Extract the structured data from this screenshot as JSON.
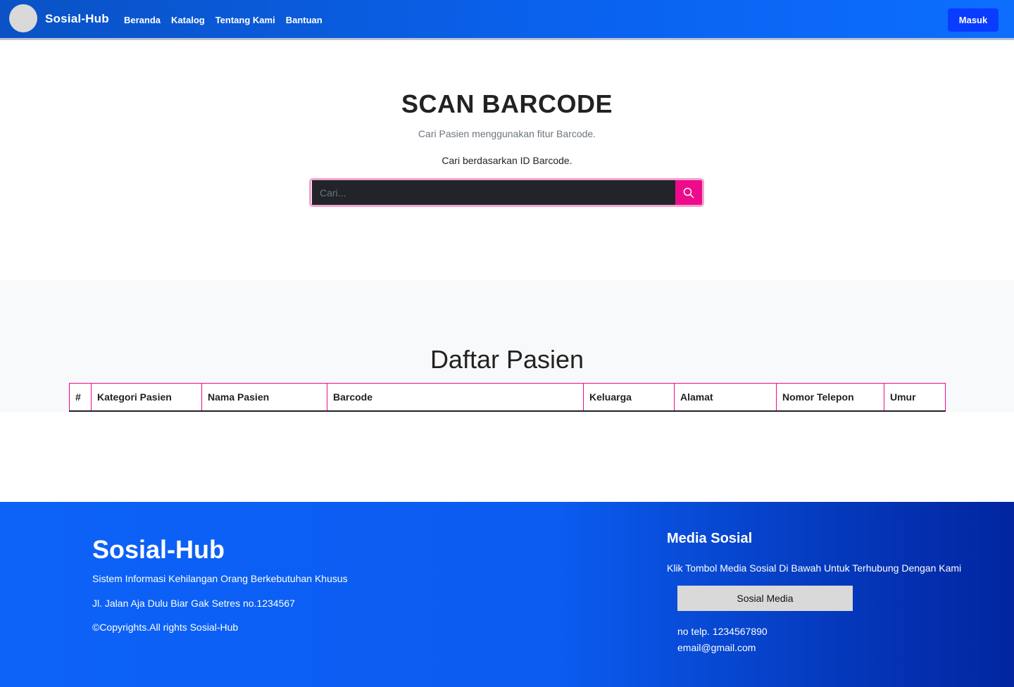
{
  "navbar": {
    "brand": "Sosial-Hub",
    "links": [
      "Beranda",
      "Katalog",
      "Tentang Kami",
      "Bantuan"
    ],
    "login_label": "Masuk"
  },
  "hero": {
    "title": "SCAN BARCODE",
    "subtitle": "Cari Pasien menggunakan fitur Barcode.",
    "search_label": "Cari berdasarkan ID Barcode.",
    "search_placeholder": "Cari...",
    "search_value": ""
  },
  "patients": {
    "title": "Daftar Pasien",
    "columns": [
      "#",
      "Kategori Pasien",
      "Nama Pasien",
      "Barcode",
      "Keluarga",
      "Alamat",
      "Nomor Telepon",
      "Umur"
    ],
    "rows": []
  },
  "footer": {
    "brand": "Sosial-Hub",
    "description": "Sistem Informasi Kehilangan Orang Berkebutuhan Khusus",
    "address": "Jl. Jalan Aja Dulu Biar Gak Setres no.1234567",
    "copyright": "©Copyrights.All rights Sosial-Hub",
    "media_title": "Media Sosial",
    "media_text": "Klik Tombol Media Sosial Di Bawah Untuk Terhubung Dengan Kami",
    "media_button": "Sosial Media",
    "phone": "no telp. 1234567890",
    "email": "email@gmail.com"
  },
  "colors": {
    "accent_pink": "#ee0b8a",
    "nav_blue": "#0a63f0",
    "button_blue": "#0a3cff"
  },
  "icons": {
    "search_button": "search-icon"
  }
}
